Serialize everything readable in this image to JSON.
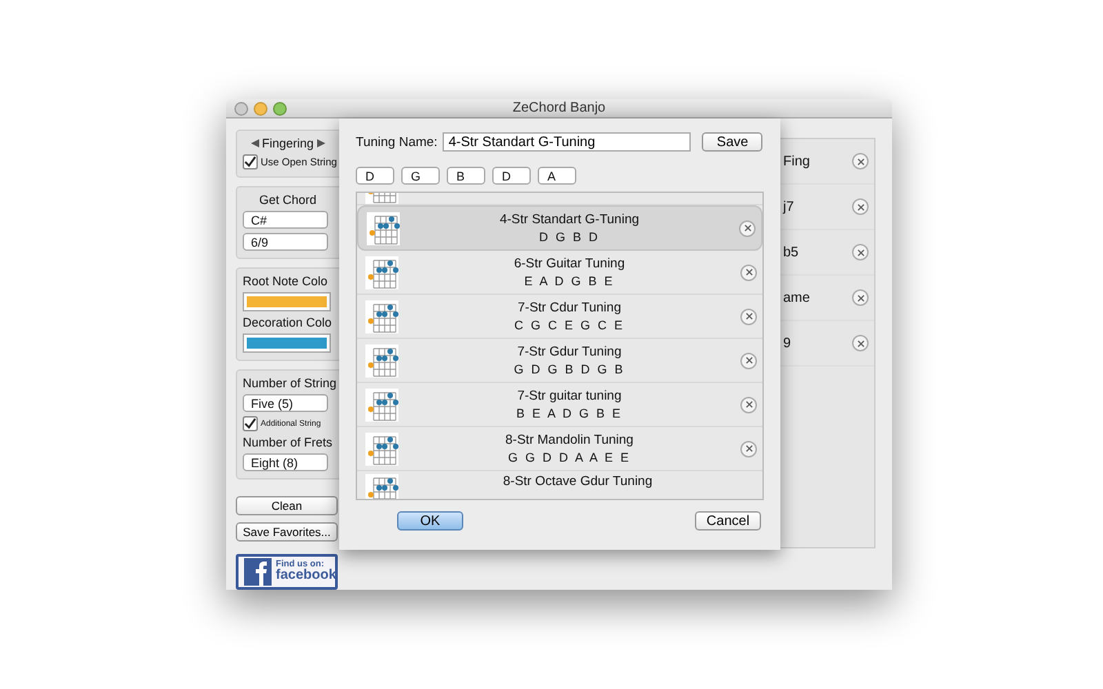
{
  "window": {
    "title": "ZeChord Banjo"
  },
  "fingering": {
    "label": "Fingering",
    "use_open_string": {
      "label": "Use Open String",
      "checked": true
    }
  },
  "get_chord": {
    "title": "Get Chord",
    "root": "C#",
    "type": "6/9"
  },
  "colors": [
    {
      "label": "Root Note Colo",
      "color": "#f5b335"
    },
    {
      "label": "Decoration Colo",
      "color": "#2e9bcb"
    }
  ],
  "strings": {
    "title": "Number of String",
    "value": "Five (5)",
    "additional": {
      "label": "Additional String",
      "checked": true
    },
    "frets_title": "Number of Frets",
    "frets_value": "Eight (8)"
  },
  "buttons": [
    "Clean",
    "Save Favorites..."
  ],
  "facebook": {
    "line1": "Find us on:",
    "line2": "facebook"
  },
  "favorites": [
    {
      "label": "Fing"
    },
    {
      "label": "j7"
    },
    {
      "label": "b5"
    },
    {
      "label": "ame"
    },
    {
      "label": "9"
    }
  ],
  "dialog": {
    "name_label": "Tuning Name:",
    "name_value": "4-Str Standart G-Tuning",
    "save": "Save",
    "pitches": [
      "D",
      "G",
      "B",
      "D",
      "A"
    ],
    "tunings": [
      {
        "name": "4-Str Standart G-Tuning",
        "notes": "D G B D",
        "selected": true
      },
      {
        "name": "6-Str Guitar Tuning",
        "notes": "E A D G B E",
        "selected": false
      },
      {
        "name": "7-Str Cdur Tuning",
        "notes": "C G C E G C E",
        "selected": false
      },
      {
        "name": "7-Str Gdur Tuning",
        "notes": "G D G B D G B",
        "selected": false
      },
      {
        "name": "7-Str guitar tuning",
        "notes": "B E A D G B E",
        "selected": false
      },
      {
        "name": "8-Str Mandolin Tuning",
        "notes": "G G D D A A E E",
        "selected": false
      },
      {
        "name": "8-Str Octave Gdur Tuning",
        "selected": false
      }
    ],
    "ok": "OK",
    "cancel": "Cancel"
  }
}
